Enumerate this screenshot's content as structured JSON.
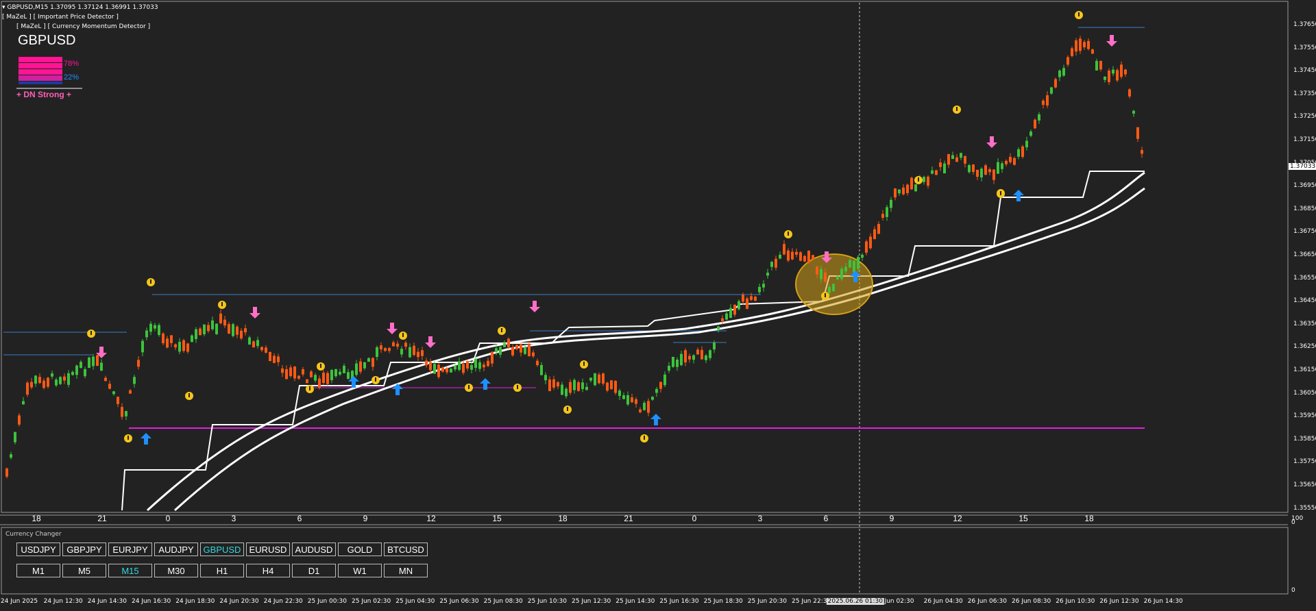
{
  "header": {
    "symbol_line": "GBPUSD,M15  1.37095 1.37124 1.36991 1.37033",
    "indicator_1": "[ MaZeL ] [ Important Price Detector ]",
    "indicator_2": "[ MaZeL ] [ Currency Momentum Detector ]"
  },
  "momentum": {
    "symbol": "GBPUSD",
    "pct_down": "78%",
    "pct_up": "22%",
    "strength_label": "+ DN Strong +",
    "down_fraction": 0.78,
    "up_fraction": 0.22,
    "colors": {
      "down": "#ff1493",
      "up": "#1e90ff",
      "label": "#ff5fb8"
    }
  },
  "price_axis": {
    "labels": [
      "1.37650",
      "1.37550",
      "1.37450",
      "1.37350",
      "1.37250",
      "1.37150",
      "1.37050",
      "1.36950",
      "1.36850",
      "1.36750",
      "1.36650",
      "1.36550",
      "1.36450",
      "1.36350",
      "1.36250",
      "1.36150",
      "1.36050",
      "1.35950",
      "1.35850",
      "1.35750",
      "1.35650",
      "1.35550"
    ],
    "current_price": "1.37033"
  },
  "hour_axis": [
    "18",
    "21",
    "0",
    "3",
    "6",
    "9",
    "12",
    "15",
    "18",
    "21",
    "0",
    "3",
    "6",
    "9",
    "12",
    "15",
    "18"
  ],
  "date_axis": [
    "24 Jun 2025",
    "24 Jun 12:30",
    "24 Jun 14:30",
    "24 Jun 16:30",
    "24 Jun 18:30",
    "24 Jun 20:30",
    "24 Jun 22:30",
    "25 Jun 00:30",
    "25 Jun 02:30",
    "25 Jun 04:30",
    "25 Jun 06:30",
    "25 Jun 08:30",
    "25 Jun 10:30",
    "25 Jun 12:30",
    "25 Jun 14:30",
    "25 Jun 16:30",
    "25 Jun 18:30",
    "25 Jun 20:30",
    "25 Jun 22:30",
    "2025.06.26 01:30",
    "Jun 02:30",
    "26 Jun 04:30",
    "26 Jun 06:30",
    "26 Jun 08:30",
    "26 Jun 10:30",
    "26 Jun 12:30",
    "26 Jun 14:30"
  ],
  "sub_scale": {
    "top": "100",
    "zero_top": "0",
    "bottom": "0"
  },
  "currency_changer": {
    "title": "Currency Changer",
    "symbols": [
      "USDJPY",
      "GBPJPY",
      "EURJPY",
      "AUDJPY",
      "GBPUSD",
      "EURUSD",
      "AUDUSD",
      "GOLD",
      "BTCUSD"
    ],
    "timeframes": [
      "M1",
      "M5",
      "M15",
      "M30",
      "H1",
      "H4",
      "D1",
      "W1",
      "MN"
    ],
    "active_symbol": "GBPUSD",
    "active_timeframe": "M15",
    "active_color": "#34d8e0"
  },
  "colors": {
    "background": "#222222",
    "bull": "#3cc43c",
    "bear": "#ff5a14",
    "signal_yellow": "#f5c518",
    "arrow_pink": "#ff6ec7",
    "arrow_blue": "#1e90ff",
    "level_blue": "#3b7fc4",
    "level_magenta": "#e020e0",
    "ma_white": "#ffffff",
    "highlight": "#d4a017"
  }
}
